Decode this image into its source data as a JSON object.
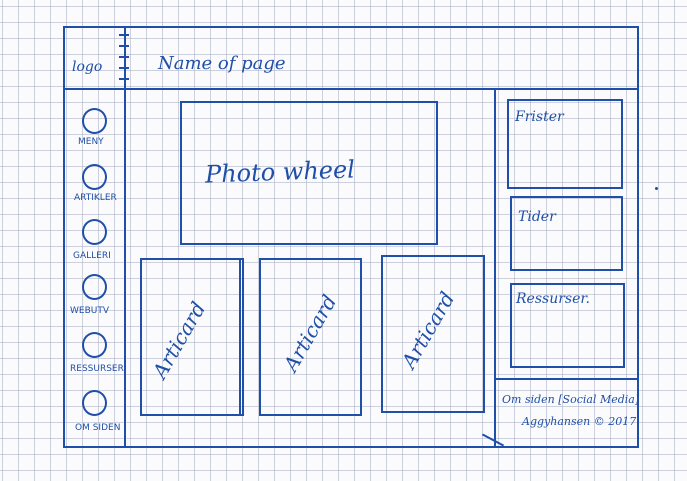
{
  "header": {
    "logo": "logo",
    "title": "Name of page"
  },
  "sidebar": {
    "items": [
      {
        "label": "MENY"
      },
      {
        "label": "ARTIKLER"
      },
      {
        "label": "GALLERI"
      },
      {
        "label": "WEBUTV"
      },
      {
        "label": "RESSURSER"
      },
      {
        "label": "OM SIDEN"
      }
    ]
  },
  "main": {
    "photo_wheel_label": "Photo wheel",
    "cards": [
      {
        "label": "Articard"
      },
      {
        "label": "Articard"
      },
      {
        "label": "Articard"
      }
    ]
  },
  "right_panel": {
    "boxes": [
      {
        "label": "Frister"
      },
      {
        "label": "Tider"
      },
      {
        "label": "Ressurser."
      }
    ],
    "footer": {
      "line_1": "Om siden [Social Media]",
      "line_2": "Aggyhansen © 2017"
    }
  },
  "colors": {
    "ink": "#1f4fa8",
    "paper": "#fbfbfd",
    "grid": "#a5afc3"
  }
}
